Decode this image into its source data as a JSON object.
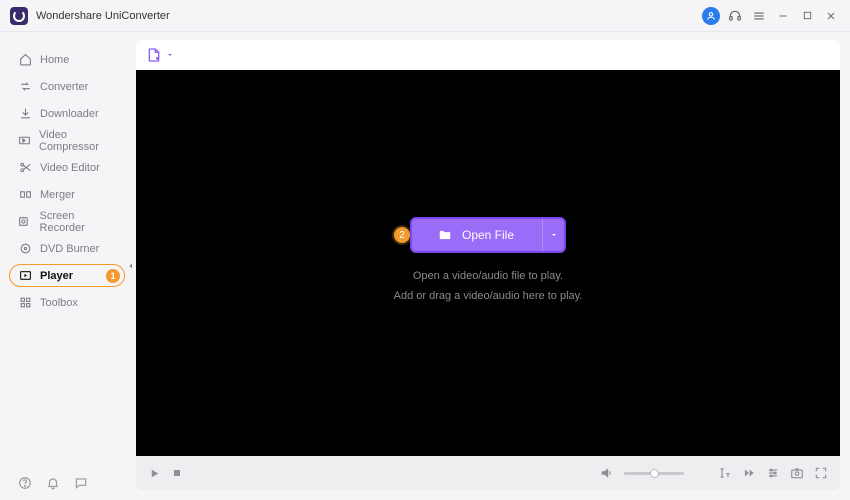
{
  "app": {
    "title": "Wondershare UniConverter"
  },
  "sidebar": {
    "items": [
      {
        "label": "Home",
        "icon": "home"
      },
      {
        "label": "Converter",
        "icon": "converter"
      },
      {
        "label": "Downloader",
        "icon": "downloader"
      },
      {
        "label": "Video Compressor",
        "icon": "compressor"
      },
      {
        "label": "Video Editor",
        "icon": "editor"
      },
      {
        "label": "Merger",
        "icon": "merger"
      },
      {
        "label": "Screen Recorder",
        "icon": "recorder"
      },
      {
        "label": "DVD Burner",
        "icon": "dvd"
      },
      {
        "label": "Player",
        "icon": "player",
        "active": true,
        "badge": "1"
      },
      {
        "label": "Toolbox",
        "icon": "toolbox"
      }
    ]
  },
  "player": {
    "open_file_label": "Open File",
    "open_callout_badge": "2",
    "hint_line1": "Open a video/audio file to play.",
    "hint_line2": "Add or drag a video/audio here to play."
  },
  "colors": {
    "accent_purple": "#9a6cf7",
    "accent_orange": "#f59a2e",
    "avatar_blue": "#2b7de9"
  }
}
